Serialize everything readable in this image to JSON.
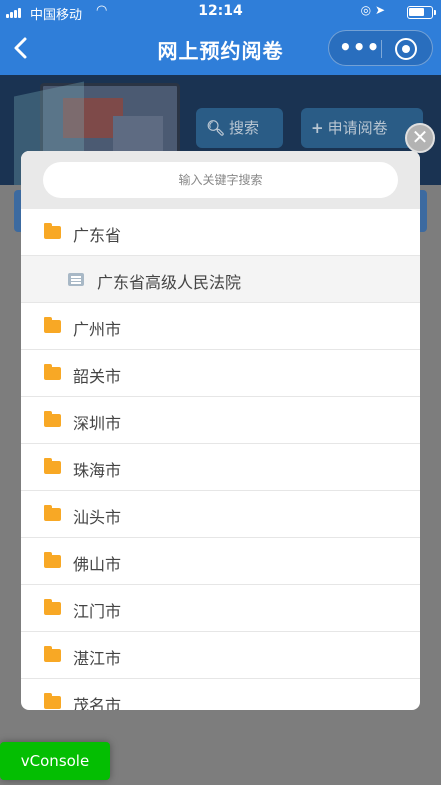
{
  "status_bar": {
    "carrier": "中国移动",
    "time": "12:14"
  },
  "nav": {
    "title": "网上预约阅卷"
  },
  "background": {
    "search_label": "搜索",
    "apply_label": "申请阅卷"
  },
  "popup": {
    "search_placeholder": "输入关键字搜索",
    "items": [
      {
        "type": "folder",
        "label": "广东省"
      },
      {
        "type": "document",
        "label": "广东省高级人民法院"
      },
      {
        "type": "folder",
        "label": "广州市"
      },
      {
        "type": "folder",
        "label": "韶关市"
      },
      {
        "type": "folder",
        "label": "深圳市"
      },
      {
        "type": "folder",
        "label": "珠海市"
      },
      {
        "type": "folder",
        "label": "汕头市"
      },
      {
        "type": "folder",
        "label": "佛山市"
      },
      {
        "type": "folder",
        "label": "江门市"
      },
      {
        "type": "folder",
        "label": "湛江市"
      },
      {
        "type": "folder",
        "label": "茂名市"
      }
    ]
  },
  "vconsole": {
    "label": "vConsole"
  },
  "colors": {
    "nav_bg": "#2f7ed9",
    "folder": "#f8a825",
    "vconsole": "#04be02"
  }
}
